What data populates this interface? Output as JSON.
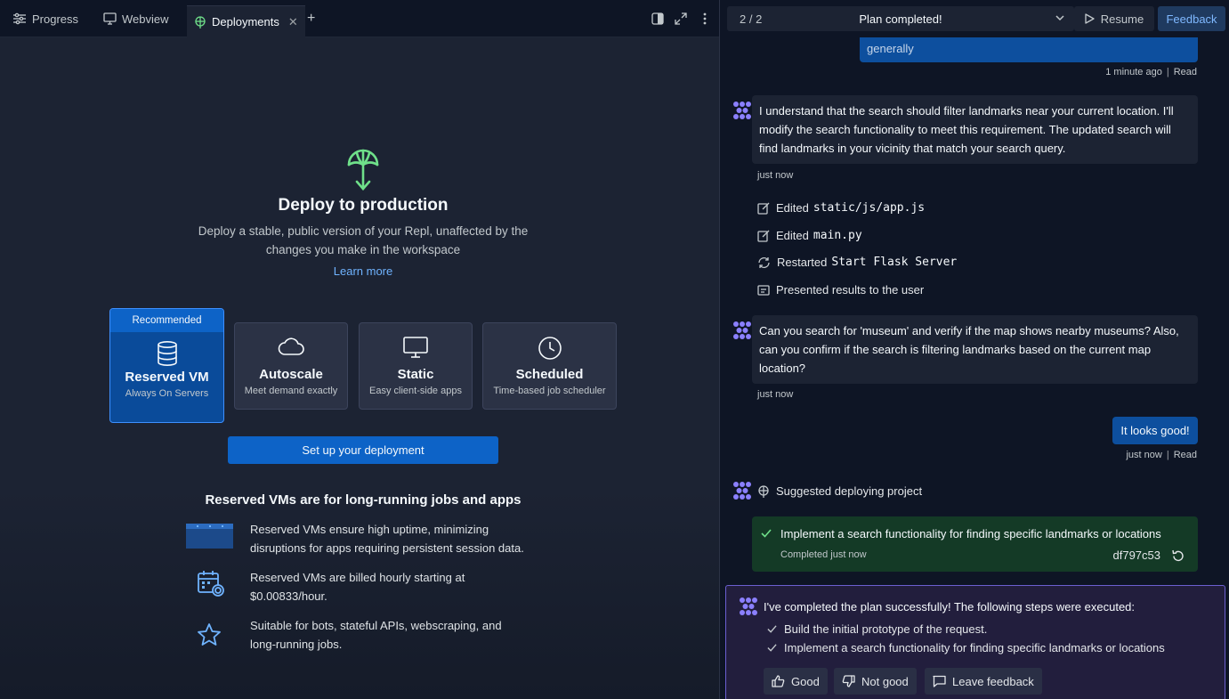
{
  "tabs": [
    {
      "label": "Progress",
      "icon": "sliders-icon"
    },
    {
      "label": "Webview",
      "icon": "monitor-icon"
    },
    {
      "label": "Deployments",
      "icon": "deploy-icon",
      "active": true
    }
  ],
  "deploy": {
    "title": "Deploy to production",
    "subtitle_line1": "Deploy a stable, public version of your Repl, unaffected by the",
    "subtitle_line2": "changes you make in the workspace",
    "learn_more": "Learn more",
    "options": [
      {
        "badge": "Recommended",
        "title": "Reserved VM",
        "subtitle": "Always On Servers",
        "icon": "database-icon"
      },
      {
        "title": "Autoscale",
        "subtitle": "Meet demand exactly",
        "icon": "cloud-icon"
      },
      {
        "title": "Static",
        "subtitle": "Easy client-side apps",
        "icon": "monitor-icon"
      },
      {
        "title": "Scheduled",
        "subtitle": "Time-based job scheduler",
        "icon": "clock-icon"
      }
    ],
    "setup_button": "Set up your deployment",
    "reserved_title": "Reserved VMs are for long-running jobs and apps",
    "features": [
      {
        "line1": "Reserved VMs ensure high uptime, minimizing",
        "line2": "disruptions for apps requiring persistent session data."
      },
      {
        "line1": "Reserved VMs are billed hourly starting at",
        "line2": "$0.00833/hour."
      },
      {
        "line1": "Suitable for bots, stateful APIs, webscraping, and",
        "line2": "long-running jobs."
      }
    ]
  },
  "plan": {
    "counter": "2 / 2",
    "title": "Plan completed!",
    "resume": "Resume",
    "feedback": "Feedback"
  },
  "chat": {
    "user_msg_1": "generally",
    "user_msg_1_time": "1 minute ago",
    "read": "Read",
    "agent_msg_1": "I understand that the search should filter landmarks near your current location. I'll modify the search functionality to meet this requirement. The updated search will find landmarks in your vicinity that match your search query.",
    "agent_msg_1_time": "just now",
    "actions": [
      {
        "verb": "Edited",
        "target": "static/js/app.js"
      },
      {
        "verb": "Edited",
        "target": "main.py"
      },
      {
        "verb": "Restarted",
        "target": "Start Flask Server"
      },
      {
        "verb": "Presented results to the user",
        "target": ""
      }
    ],
    "agent_msg_2": "Can you search for 'museum' and verify if the map shows nearby museums? Also, can you confirm if the search is filtering landmarks based on the current map location?",
    "agent_msg_2_time": "just now",
    "user_msg_2": "It looks good!",
    "user_msg_2_time": "just now",
    "suggested": "Suggested deploying project",
    "completed_task": "Implement a search functionality for finding specific landmarks or locations",
    "completed_status": "Completed just now",
    "commit_hash": "df797c53",
    "final_msg": "I've completed the plan successfully! The following steps were executed:",
    "steps": [
      "Build the initial prototype of the request.",
      "Implement a search functionality for finding specific landmarks or locations"
    ],
    "buttons": {
      "good": "Good",
      "not_good": "Not good",
      "leave_feedback": "Leave feedback"
    }
  },
  "colors": {
    "accent": "#0d63c7",
    "link": "#6fb3ff",
    "success": "#143a26",
    "agent": "#8b80ff"
  }
}
